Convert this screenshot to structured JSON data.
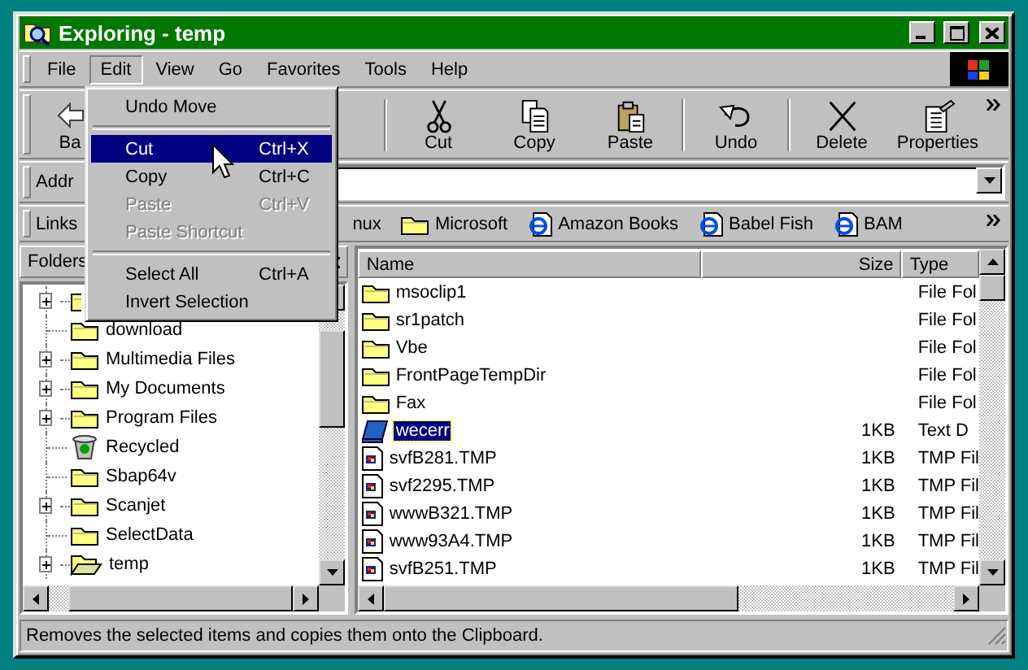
{
  "window": {
    "title": "Exploring - temp"
  },
  "menu_bar": [
    {
      "label": "File",
      "selected": false
    },
    {
      "label": "Edit",
      "selected": true
    },
    {
      "label": "View",
      "selected": false
    },
    {
      "label": "Go",
      "selected": false
    },
    {
      "label": "Favorites",
      "selected": false
    },
    {
      "label": "Tools",
      "selected": false
    },
    {
      "label": "Help",
      "selected": false
    }
  ],
  "toolbar": {
    "groups": [
      [
        {
          "label": "Ba"
        }
      ],
      [
        {
          "label": "Cut"
        },
        {
          "label": "Copy"
        },
        {
          "label": "Paste"
        }
      ],
      [
        {
          "label": "Undo"
        }
      ],
      [
        {
          "label": "Delete"
        },
        {
          "label": "Properties"
        }
      ]
    ]
  },
  "address_bar": {
    "label": "Addr"
  },
  "links_bar": {
    "label": "Links",
    "items": [
      {
        "label": "nux"
      },
      {
        "label": "Microsoft",
        "kind": "folder"
      },
      {
        "label": "Amazon Books",
        "kind": "web"
      },
      {
        "label": "Babel Fish",
        "kind": "web"
      },
      {
        "label": "BAM",
        "kind": "web"
      }
    ]
  },
  "folders_pane": {
    "title": "Folders",
    "items": [
      {
        "kind": "folder",
        "expandable": true
      },
      {
        "label": "download",
        "kind": "folder",
        "expandable": false
      },
      {
        "label": "Multimedia Files",
        "kind": "folder",
        "expandable": true
      },
      {
        "label": "My Documents",
        "kind": "folder",
        "expandable": true
      },
      {
        "label": "Program Files",
        "kind": "folder",
        "expandable": true
      },
      {
        "label": "Recycled",
        "kind": "recycle",
        "expandable": false
      },
      {
        "label": "Sbap64v",
        "kind": "folder",
        "expandable": false
      },
      {
        "label": "Scanjet",
        "kind": "folder",
        "expandable": true
      },
      {
        "label": "SelectData",
        "kind": "folder",
        "expandable": false
      },
      {
        "label": "temp",
        "kind": "open-folder",
        "expandable": true
      }
    ]
  },
  "file_list": {
    "columns": [
      "Name",
      "Size",
      "Type"
    ],
    "rows": [
      {
        "name": "msoclip1",
        "type": "File Fol",
        "kind": "folder",
        "selected": false
      },
      {
        "name": "sr1patch",
        "type": "File Fol",
        "kind": "folder",
        "selected": false
      },
      {
        "name": "Vbe",
        "type": "File Fol",
        "kind": "folder",
        "selected": false
      },
      {
        "name": "FrontPageTempDir",
        "type": "File Fol",
        "kind": "folder",
        "selected": false
      },
      {
        "name": "Fax",
        "type": "File Fol",
        "kind": "folder",
        "selected": false
      },
      {
        "name": "wecerr",
        "size": "1KB",
        "type": "Text D",
        "kind": "text",
        "selected": true
      },
      {
        "name": "svfB281.TMP",
        "size": "1KB",
        "type": "TMP Fil",
        "kind": "tmp",
        "selected": false
      },
      {
        "name": "svf2295.TMP",
        "size": "1KB",
        "type": "TMP Fil",
        "kind": "tmp",
        "selected": false
      },
      {
        "name": "wwwB321.TMP",
        "size": "1KB",
        "type": "TMP Fil",
        "kind": "tmp",
        "selected": false
      },
      {
        "name": "www93A4.TMP",
        "size": "1KB",
        "type": "TMP Fil",
        "kind": "tmp",
        "selected": false
      },
      {
        "name": "svfB251.TMP",
        "size": "1KB",
        "type": "TMP Fil",
        "kind": "tmp",
        "selected": false
      }
    ]
  },
  "status_bar": {
    "text": "Removes the selected items and copies them onto the Clipboard."
  },
  "edit_menu": {
    "items": [
      {
        "kind": "item",
        "label": "Undo Move",
        "selected": false,
        "disabled": false
      },
      {
        "kind": "separator"
      },
      {
        "kind": "item",
        "label": "Cut",
        "shortcut": "Ctrl+X",
        "selected": true,
        "disabled": false
      },
      {
        "kind": "item",
        "label": "Copy",
        "shortcut": "Ctrl+C",
        "selected": false,
        "disabled": false
      },
      {
        "kind": "item",
        "label": "Paste",
        "shortcut": "Ctrl+V",
        "selected": false,
        "disabled": true
      },
      {
        "kind": "item",
        "label": "Paste Shortcut",
        "selected": false,
        "disabled": true
      },
      {
        "kind": "separator"
      },
      {
        "kind": "item",
        "label": "Select All",
        "shortcut": "Ctrl+A",
        "selected": false,
        "disabled": false
      },
      {
        "kind": "item",
        "label": "Invert Selection",
        "selected": false,
        "disabled": false
      }
    ]
  }
}
